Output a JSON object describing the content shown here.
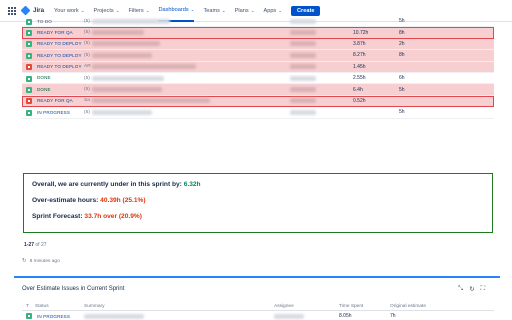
{
  "nav": {
    "logo": "Jira",
    "items": [
      {
        "label": "Your work",
        "chevron": true,
        "active": false
      },
      {
        "label": "Projects",
        "chevron": true,
        "active": false
      },
      {
        "label": "Filters",
        "chevron": true,
        "active": false
      },
      {
        "label": "Dashboards",
        "chevron": true,
        "active": true
      },
      {
        "label": "Teams",
        "chevron": true,
        "active": false
      },
      {
        "label": "Plans",
        "chevron": true,
        "active": false
      },
      {
        "label": "Apps",
        "chevron": true,
        "active": false
      }
    ],
    "create": "Create"
  },
  "issues": [
    {
      "status": "TO DO",
      "type": "story",
      "count": "(5)",
      "spent": "",
      "estimate": "5h",
      "highlight": false
    },
    {
      "status": "READY FOR QA",
      "type": "story",
      "count": "(5)",
      "spent": "10.72h",
      "estimate": "8h",
      "highlight": true
    },
    {
      "status": "READY TO DEPLOY",
      "type": "story",
      "count": "(5)",
      "spent": "3.87h",
      "estimate": "2h",
      "highlight": true
    },
    {
      "status": "READY TO DEPLOY",
      "type": "story",
      "count": "(5)",
      "spent": "8.27h",
      "estimate": "8h",
      "highlight": true
    },
    {
      "status": "READY TO DEPLOY",
      "type": "bug",
      "count": "AR",
      "spent": "1.45h",
      "estimate": "",
      "highlight": true
    },
    {
      "status": "DONE",
      "type": "story",
      "count": "(5)",
      "spent": "2.55h",
      "estimate": "6h",
      "highlight": false
    },
    {
      "status": "DONE",
      "type": "story",
      "count": "(5)",
      "spent": "6.4h",
      "estimate": "5h",
      "highlight": true
    },
    {
      "status": "READY FOR QA",
      "type": "bug",
      "count": "Sa",
      "spent": "0.52h",
      "estimate": "",
      "highlight": true
    },
    {
      "status": "IN PROGRESS",
      "type": "story",
      "count": "(5)",
      "spent": "",
      "estimate": "5h",
      "highlight": false
    }
  ],
  "summary": {
    "line1_label": "Overall, we are currently under in this sprint by: ",
    "line1_value": "6.32h",
    "line2_label": "Over-estimate hours: ",
    "line2_value": "40.39h (25.1%)",
    "line3_label": "Sprint Forecast: ",
    "line3_value": "33.7h over (20.9%)"
  },
  "pager": {
    "range": "1-27",
    "of": "of 27"
  },
  "refresh": {
    "text": "8 minutes ago"
  },
  "gadget": {
    "title": "Over Estimate Issues in Current Sprint",
    "columns": [
      "T",
      "Status",
      "Summary",
      "Assignee",
      "Time Spent",
      "Original estimate"
    ],
    "first_row": {
      "status": "IN PROGRESS",
      "spent": "8.05h",
      "estimate": "7h"
    }
  },
  "colors": {
    "accent": "#0052cc",
    "over": "#de350b",
    "under": "#00875a",
    "row_highlight": "#f8cfd1"
  }
}
